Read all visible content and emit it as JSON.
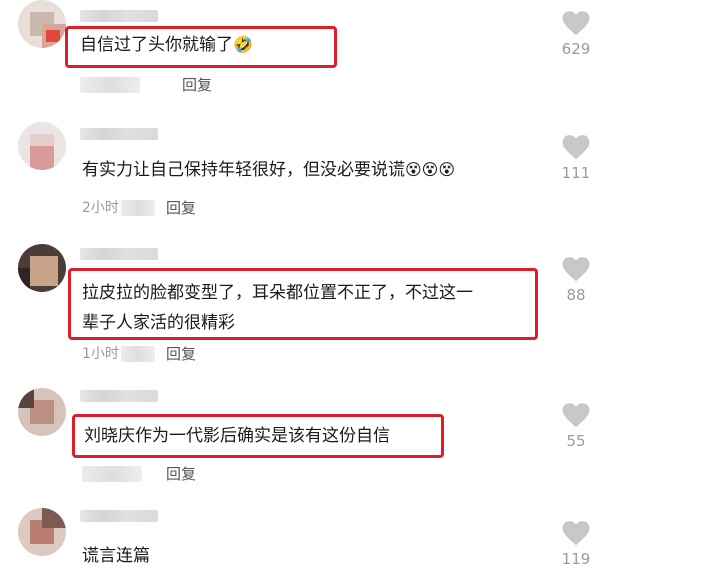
{
  "comments": [
    {
      "text": "自信过了头你就输了",
      "emoji": "🤣",
      "meta": "",
      "reply": "回复",
      "likes": "629"
    },
    {
      "text": "有实力让自己保持年轻很好，但没必要说谎",
      "emoji": "😵😵😵",
      "meta": "2小时",
      "reply": "回复",
      "likes": "111"
    },
    {
      "text_line1": "拉皮拉的脸都变型了，耳朵都位置不正了，不过这一",
      "text_line2": "辈子人家活的很精彩",
      "meta": "1小时",
      "reply": "回复",
      "likes": "88"
    },
    {
      "text": "刘晓庆作为一代影后确实是该有这份自信",
      "meta": "",
      "reply": "回复",
      "likes": "55"
    },
    {
      "text": "谎言连篇",
      "likes": "119"
    }
  ],
  "colors": {
    "highlight": "#d9202b",
    "heart": "#c8c8c8",
    "muted": "#9a9a9a"
  },
  "icons": {
    "like": "heart-icon"
  }
}
